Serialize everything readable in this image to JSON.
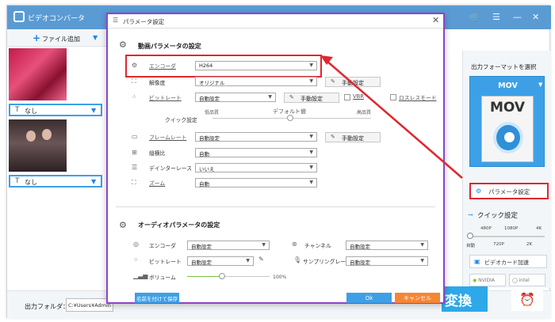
{
  "app": {
    "title": "ビデオコンバータ",
    "add_file": "ファイル追加",
    "subtitle_none_1": "なし",
    "subtitle_none_2": "なし",
    "subtitle_icon": "T",
    "output_folder_label": "出力フォルダ：",
    "output_folder_path": "C:¥Users¥Admin",
    "convert_button": "変換"
  },
  "right_pane": {
    "title": "出力フォーマットを選択",
    "format": "MOV",
    "format_icon_text": "MOV",
    "param_button": "パラメータ設定",
    "quick_setting": "クイック設定",
    "ticks_top": [
      "480P",
      "1080P",
      "4K"
    ],
    "ticks_bottom": [
      "自動",
      "720P",
      "2K"
    ],
    "gpu_accel": "ビデオカード加速",
    "chip_nvidia": "NVIDIA",
    "chip_intel": "intel"
  },
  "dialog": {
    "title": "パラメータ設定",
    "video_section": "動画パラメータの設定",
    "encoder_label": "エンコーダ",
    "encoder_value": "H264",
    "resolution_label": "解像度",
    "resolution_value": "オリジナル",
    "manual_button": "手動設定",
    "bitrate_label": "ビットレート",
    "bitrate_value": "自動設定",
    "vbr_label": "VBR",
    "lossless_label": "ロスレスモード",
    "quick_label": "クイック設定",
    "quality_low": "低品質",
    "quality_default": "デフォルト値",
    "quality_high": "高品質",
    "framerate_label": "フレームレート",
    "framerate_value": "自動設定",
    "aspect_label": "縦横比",
    "aspect_value": "自動",
    "deinterlace_label": "デインターレース",
    "deinterlace_value": "いいえ",
    "zoom_label": "ズーム",
    "zoom_value": "自動",
    "audio_section": "オーディオパラメータの設定",
    "a_encoder_label": "エンコーダ",
    "a_encoder_value": "自動設定",
    "a_bitrate_label": "ビットレート",
    "a_bitrate_value": "自動設定",
    "volume_label": "ボリューム",
    "volume_value": "100%",
    "volume_level": 0.42,
    "channel_label": "チャンネル",
    "channel_value": "自動設定",
    "samplerate_label": "サンプリングレート",
    "samplerate_value": "自動設定",
    "save_as_button": "名前を付けて保存",
    "ok_button": "Ok",
    "cancel_button": "キャンセル"
  },
  "colors": {
    "accent": "#3da0e6",
    "highlight": "#e0272e",
    "dialog_border": "#8e44c8",
    "cancel": "#f58634"
  }
}
